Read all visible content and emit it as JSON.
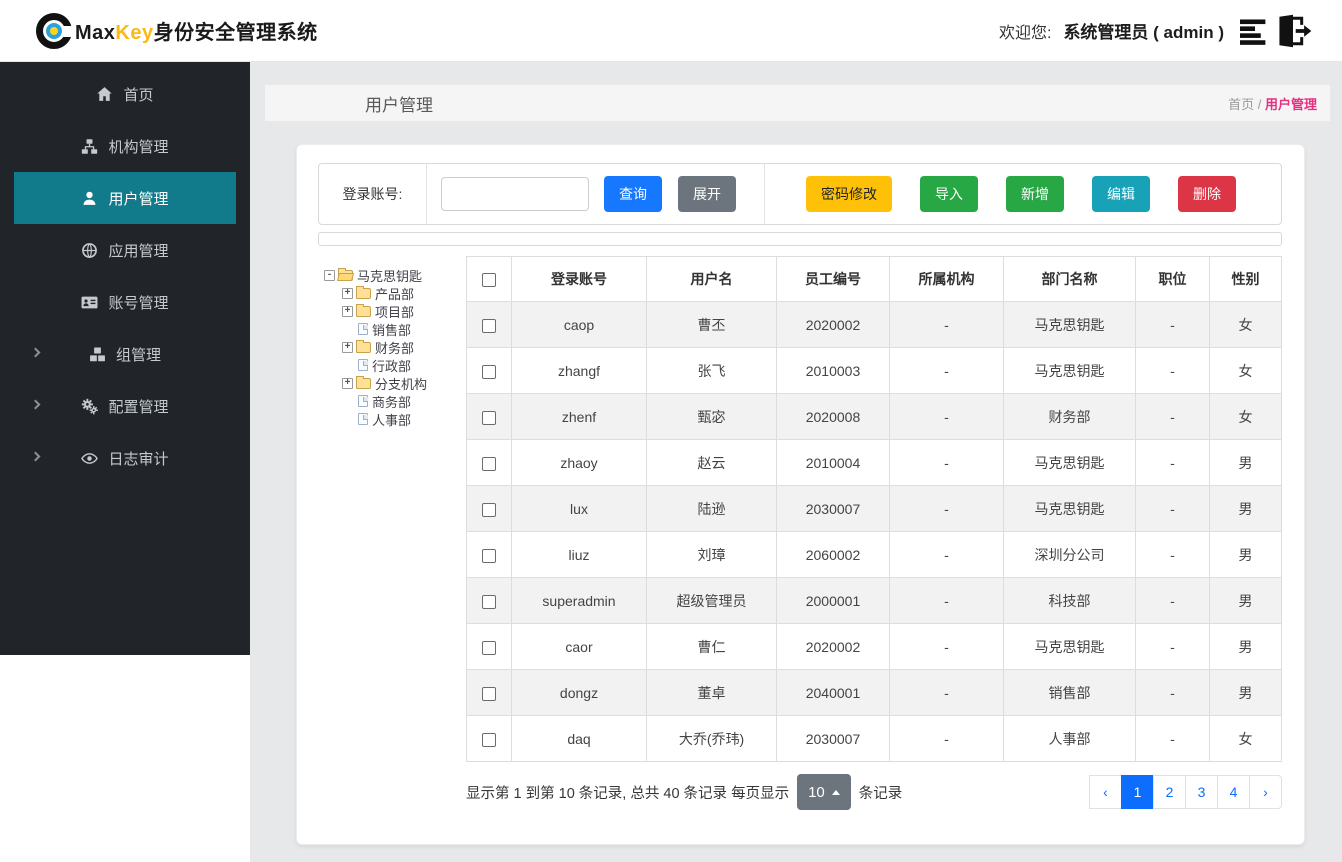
{
  "theme": {
    "sidebar_bg": "#212529",
    "sidebar_active": "#117a8b",
    "page_bg": "#e7e8ea",
    "brand_yellow": "#fdb913",
    "breadcrumb_pink": "#e7307f",
    "btn_primary": "#1677ff",
    "btn_secondary": "#6c757d",
    "btn_warning": "#ffc107",
    "btn_success": "#28a745",
    "btn_info": "#17a2b8",
    "btn_danger": "#dc3545",
    "pagination_active": "#0d6efd",
    "stripe": "#f2f2f2"
  },
  "header": {
    "brand_max": "Max",
    "brand_key": "Key",
    "brand_suffix": "身份安全管理系统",
    "welcome_label": "欢迎您:",
    "user": "系统管理员 ( admin )"
  },
  "sidebar": {
    "items": [
      {
        "label": "首页",
        "icon": "home"
      },
      {
        "label": "机构管理",
        "icon": "sitemap"
      },
      {
        "label": "用户管理",
        "icon": "user",
        "active": true
      },
      {
        "label": "应用管理",
        "icon": "globe"
      },
      {
        "label": "账号管理",
        "icon": "idcard"
      },
      {
        "label": "组管理",
        "icon": "cubes",
        "chevron": true
      },
      {
        "label": "配置管理",
        "icon": "gears",
        "chevron": true
      },
      {
        "label": "日志审计",
        "icon": "eye",
        "chevron": true
      }
    ]
  },
  "page": {
    "title": "用户管理",
    "breadcrumb": {
      "home": "首页",
      "sep": " / ",
      "current": "用户管理"
    }
  },
  "search": {
    "label": "登录账号:",
    "input_value": "",
    "query_btn": "查询",
    "expand_btn": "展开"
  },
  "actions": [
    {
      "label": "密码修改",
      "variant": "warning"
    },
    {
      "label": "导入",
      "variant": "success"
    },
    {
      "label": "新增",
      "variant": "success"
    },
    {
      "label": "编辑",
      "variant": "info"
    },
    {
      "label": "删除",
      "variant": "danger"
    }
  ],
  "tree": {
    "nodes": [
      {
        "label": "马克思钥匙",
        "level": 0,
        "toggle": "minus",
        "icon": "folder-open"
      },
      {
        "label": "产品部",
        "level": 1,
        "toggle": "plus",
        "icon": "folder"
      },
      {
        "label": "项目部",
        "level": 1,
        "toggle": "plus",
        "icon": "folder"
      },
      {
        "label": "销售部",
        "level": 1,
        "toggle": "none",
        "icon": "file"
      },
      {
        "label": "财务部",
        "level": 1,
        "toggle": "plus",
        "icon": "folder"
      },
      {
        "label": "行政部",
        "level": 1,
        "toggle": "none",
        "icon": "file"
      },
      {
        "label": "分支机构",
        "level": 1,
        "toggle": "plus",
        "icon": "folder"
      },
      {
        "label": "商务部",
        "level": 1,
        "toggle": "none",
        "icon": "file"
      },
      {
        "label": "人事部",
        "level": 1,
        "toggle": "none",
        "icon": "file"
      }
    ]
  },
  "table": {
    "columns": [
      "登录账号",
      "用户名",
      "员工编号",
      "所属机构",
      "部门名称",
      "职位",
      "性别"
    ],
    "rows": [
      {
        "account": "caop",
        "name": "曹丕",
        "empno": "2020002",
        "org": "-",
        "dept": "马克思钥匙",
        "position": "-",
        "gender": "女"
      },
      {
        "account": "zhangf",
        "name": "张飞",
        "empno": "2010003",
        "org": "-",
        "dept": "马克思钥匙",
        "position": "-",
        "gender": "女"
      },
      {
        "account": "zhenf",
        "name": "甄宓",
        "empno": "2020008",
        "org": "-",
        "dept": "财务部",
        "position": "-",
        "gender": "女"
      },
      {
        "account": "zhaoy",
        "name": "赵云",
        "empno": "2010004",
        "org": "-",
        "dept": "马克思钥匙",
        "position": "-",
        "gender": "男"
      },
      {
        "account": "lux",
        "name": "陆逊",
        "empno": "2030007",
        "org": "-",
        "dept": "马克思钥匙",
        "position": "-",
        "gender": "男"
      },
      {
        "account": "liuz",
        "name": "刘璋",
        "empno": "2060002",
        "org": "-",
        "dept": "深圳分公司",
        "position": "-",
        "gender": "男"
      },
      {
        "account": "superadmin",
        "name": "超级管理员",
        "empno": "2000001",
        "org": "-",
        "dept": "科技部",
        "position": "-",
        "gender": "男"
      },
      {
        "account": "caor",
        "name": "曹仁",
        "empno": "2020002",
        "org": "-",
        "dept": "马克思钥匙",
        "position": "-",
        "gender": "男"
      },
      {
        "account": "dongz",
        "name": "董卓",
        "empno": "2040001",
        "org": "-",
        "dept": "销售部",
        "position": "-",
        "gender": "男"
      },
      {
        "account": "daq",
        "name": "大乔(乔玮)",
        "empno": "2030007",
        "org": "-",
        "dept": "人事部",
        "position": "-",
        "gender": "女"
      }
    ]
  },
  "pagination": {
    "info_prefix": "显示第 1 到第 10 条记录, 总共 40 条记录  每页显示",
    "page_size": "10",
    "info_suffix": "条记录",
    "pages": [
      {
        "label": "‹",
        "kind": "nav"
      },
      {
        "label": "1",
        "active": true
      },
      {
        "label": "2"
      },
      {
        "label": "3"
      },
      {
        "label": "4"
      },
      {
        "label": "›",
        "kind": "nav"
      }
    ]
  }
}
